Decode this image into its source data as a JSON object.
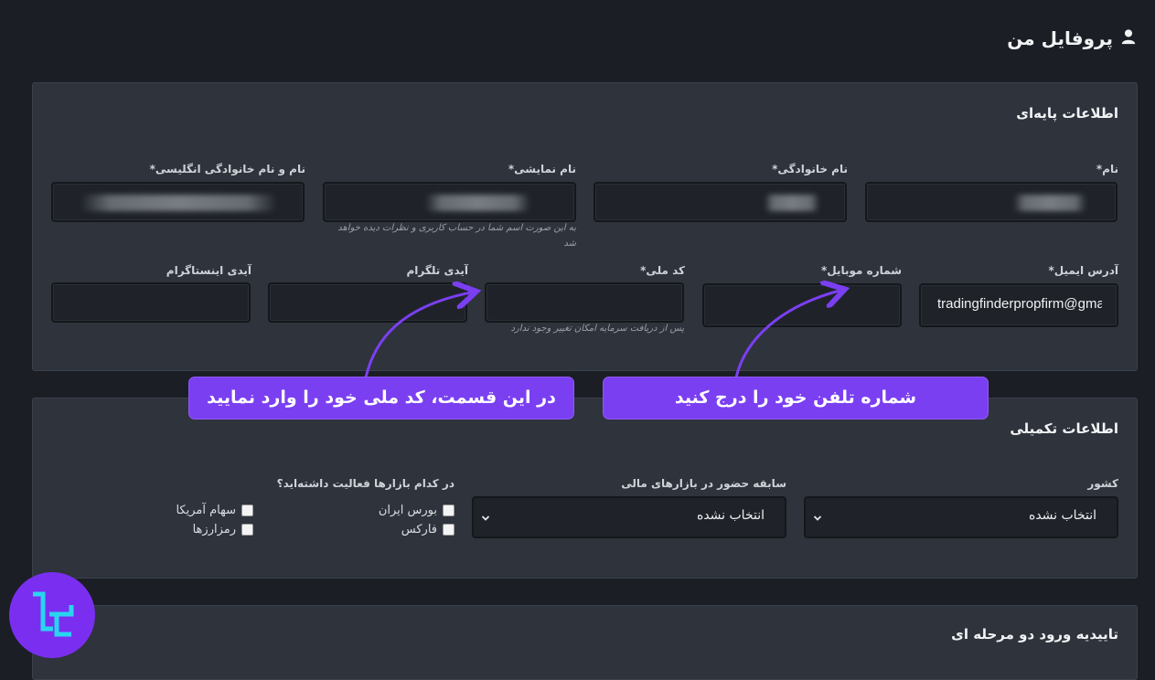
{
  "page_title": "پروفایل من",
  "page_icon": "user-icon",
  "basic": {
    "title": "اطلاعات پایه‌ای",
    "first_name_label": "نام*",
    "last_name_label": "نام خانوادگی*",
    "display_name_label": "نام نمایشی*",
    "display_name_hint": "به این صورت اسم شما در حساب کاربری و نظرات دیده خواهد شد",
    "english_name_label": "نام و نام خانوادگی انگلیسی*",
    "email_label": "آدرس ایمیل*",
    "email_value": "tradingfinderpropfirm@gmail.com",
    "mobile_label": "شماره موبایل*",
    "national_code_label": "کد ملی*",
    "national_code_hint": "پس از دریافت سرمایه امکان تغییر وجود ندارد",
    "telegram_label": "آیدی تلگرام",
    "instagram_label": "آیدی اینستاگرام"
  },
  "extra": {
    "title": "اطلاعات تکمیلی",
    "country_label": "کشور",
    "country_value": "انتخاب نشده",
    "experience_label": "سابقه حضور در بازارهای مالی",
    "experience_value": "انتخاب نشده",
    "markets_label": "در کدام بازارها فعالیت داشته‌اید؟",
    "markets": [
      "بورس ایران",
      "فارکس",
      "سهام آمریکا",
      "رمزارزها"
    ]
  },
  "twofa": {
    "title": "تاییدیه ورود دو مرحله ای"
  },
  "annotations": {
    "national_code_banner": "در این قسمت، کد ملی خود را وارد نمایید",
    "phone_banner": "شماره تلفن خود را درج کنید"
  },
  "colors": {
    "background": "#1b1e24",
    "card": "#2e333c",
    "input": "#1f2329",
    "accent": "#7b3ff2"
  }
}
